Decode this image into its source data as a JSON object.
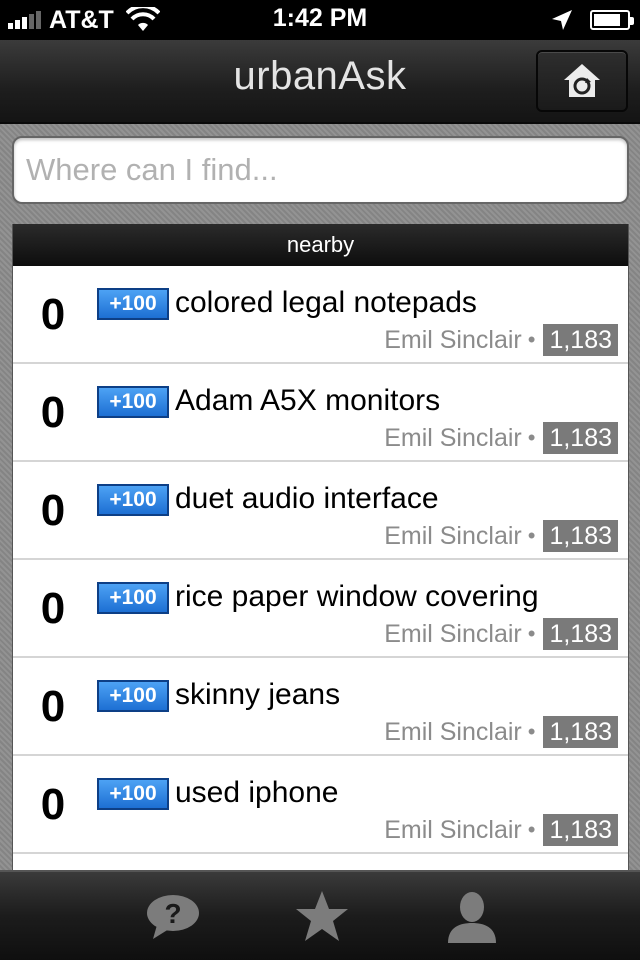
{
  "status_bar": {
    "carrier": "AT&T",
    "time": "1:42 PM",
    "icons": [
      "signal-icon",
      "wifi-icon",
      "location-icon",
      "battery-icon"
    ]
  },
  "nav": {
    "title": "urbanAsk",
    "home_icon": "home-refresh-icon"
  },
  "search": {
    "placeholder": "Where can I find...",
    "value": ""
  },
  "list": {
    "section_title": "nearby",
    "items": [
      {
        "score": "0",
        "bounty": "+100",
        "title": "colored legal notepads",
        "author": "Emil Sinclair",
        "separator": "•",
        "reputation": "1,183"
      },
      {
        "score": "0",
        "bounty": "+100",
        "title": "Adam A5X monitors",
        "author": "Emil Sinclair",
        "separator": "•",
        "reputation": "1,183"
      },
      {
        "score": "0",
        "bounty": "+100",
        "title": "duet audio interface",
        "author": "Emil Sinclair",
        "separator": "•",
        "reputation": "1,183"
      },
      {
        "score": "0",
        "bounty": "+100",
        "title": "rice paper window covering",
        "author": "Emil Sinclair",
        "separator": "•",
        "reputation": "1,183"
      },
      {
        "score": "0",
        "bounty": "+100",
        "title": "skinny jeans",
        "author": "Emil Sinclair",
        "separator": "•",
        "reputation": "1,183"
      },
      {
        "score": "0",
        "bounty": "+100",
        "title": "used iphone",
        "author": "Emil Sinclair",
        "separator": "•",
        "reputation": "1,183"
      }
    ]
  },
  "tab_bar": {
    "tabs": [
      {
        "icon": "question-bubble-icon"
      },
      {
        "icon": "star-icon"
      },
      {
        "icon": "person-icon"
      }
    ]
  },
  "colors": {
    "badge_blue": "#2f86e6",
    "reputation_gray": "#7a7a7a",
    "nav_dark": "#1e1e1e"
  }
}
